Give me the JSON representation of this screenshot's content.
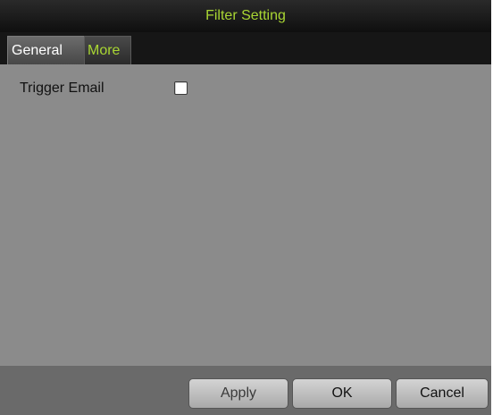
{
  "dialog": {
    "title": "Filter Setting"
  },
  "tabs": [
    {
      "label": "General",
      "active": false
    },
    {
      "label": "More",
      "active": true
    }
  ],
  "fields": {
    "trigger_email": {
      "label": "Trigger Email",
      "checked": false
    }
  },
  "buttons": {
    "apply": "Apply",
    "ok": "OK",
    "cancel": "Cancel"
  },
  "colors": {
    "accent": "#a9d633",
    "panel": "#8b8b8b",
    "titlebar": "#0f0f0f",
    "footer": "#6a6a6a"
  }
}
